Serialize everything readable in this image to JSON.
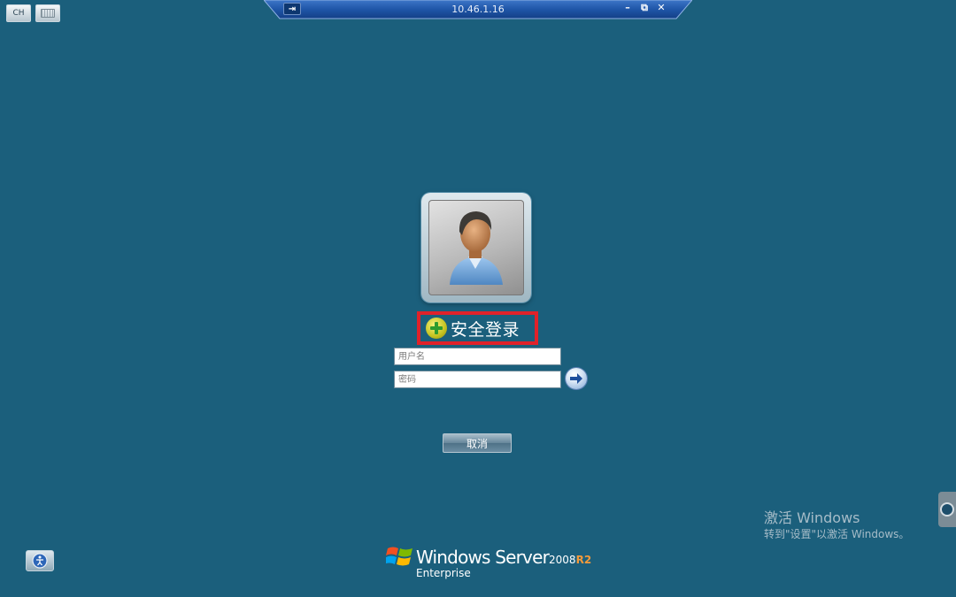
{
  "top_left": {
    "language_label": "CH",
    "keyboard_icon": "keyboard-icon"
  },
  "connection_bar": {
    "title": "10.46.1.16",
    "pin_icon": "pin-icon",
    "minimize_label": "–",
    "restore_label": "⧉",
    "close_label": "✕"
  },
  "login": {
    "avatar_icon": "user-avatar-icon",
    "secure_login_label": "安全登录",
    "secure_login_icon": "plus-shield-icon",
    "username_placeholder": "用户名",
    "username_value": "",
    "password_placeholder": "密码",
    "password_value": "",
    "submit_icon": "arrow-right-icon",
    "cancel_label": "取消"
  },
  "activation": {
    "title": "激活 Windows",
    "subtitle": "转到\"设置\"以激活 Windows。"
  },
  "branding": {
    "name": "Windows Server",
    "year": "2008",
    "release": "R2",
    "edition": "Enterprise",
    "logo_icon": "windows-flag-icon"
  },
  "ease_of_access": {
    "icon": "ease-of-access-icon"
  },
  "colors": {
    "background": "#1b5f7c",
    "highlight_border": "#e0222a",
    "r2_accent": "#f39a3b"
  }
}
